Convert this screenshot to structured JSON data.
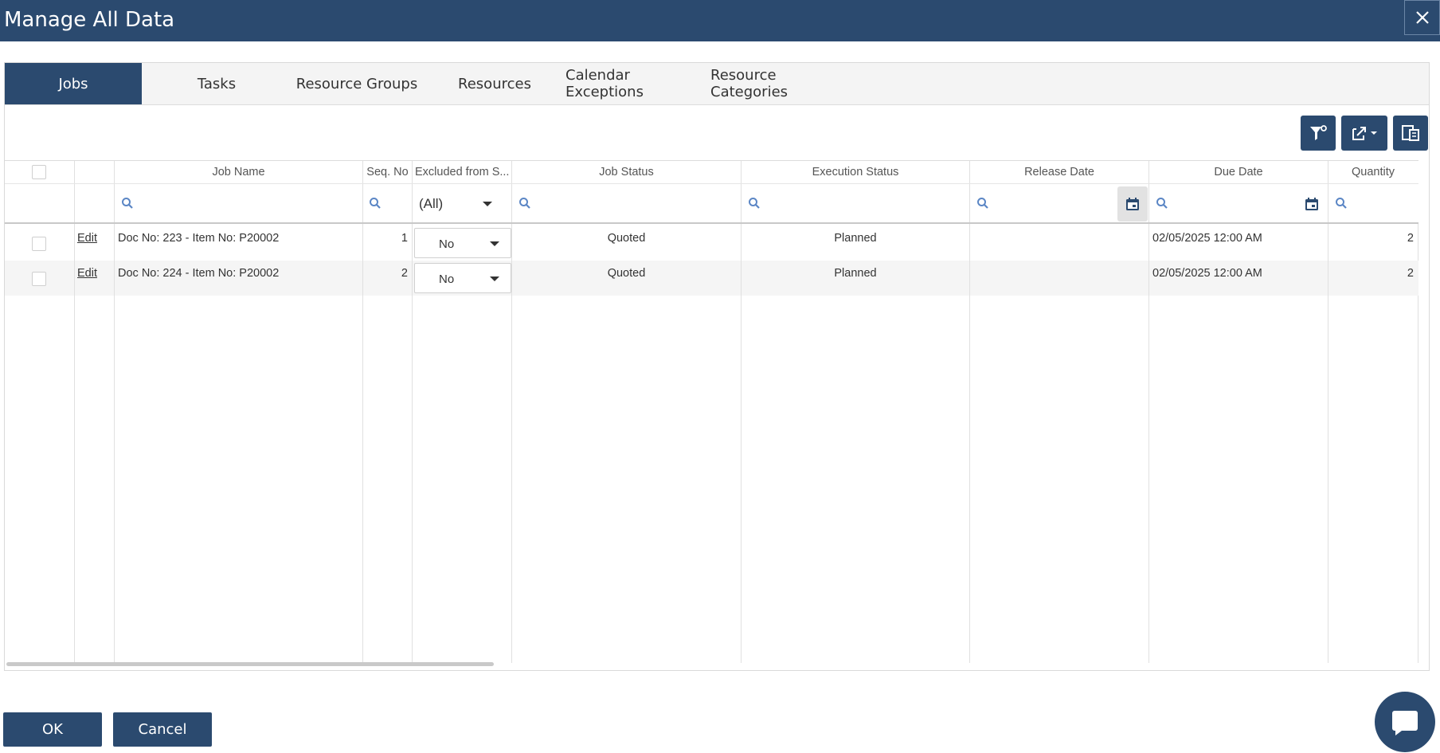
{
  "window": {
    "title": "Manage All Data"
  },
  "tabs": [
    {
      "label": "Jobs",
      "active": true
    },
    {
      "label": "Tasks",
      "active": false
    },
    {
      "label": "Resource Groups",
      "active": false
    },
    {
      "label": "Resources",
      "active": false
    },
    {
      "label": "Calendar Exceptions",
      "active": false
    },
    {
      "label": "Resource Categories",
      "active": false
    }
  ],
  "toolbar": {
    "filter_icon": "filter-settings-icon",
    "export_icon": "export-dropdown-icon",
    "chooser_icon": "column-chooser-icon"
  },
  "grid": {
    "columns": [
      "",
      "",
      "Job Name",
      "Seq. No",
      "Excluded from S...",
      "Job Status",
      "Execution Status",
      "Release Date",
      "Due Date",
      "Quantity"
    ],
    "filters": {
      "excluded": "(All)"
    },
    "rows": [
      {
        "action": "Edit",
        "job_name": "Doc No: 223 - Item No: P20002",
        "seq_no": "1",
        "excluded": "No",
        "job_status": "Quoted",
        "execution_status": "Planned",
        "release_date": "",
        "due_date": "02/05/2025 12:00 AM",
        "quantity": "2"
      },
      {
        "action": "Edit",
        "job_name": "Doc No: 224 - Item No: P20002",
        "seq_no": "2",
        "excluded": "No",
        "job_status": "Quoted",
        "execution_status": "Planned",
        "release_date": "",
        "due_date": "02/05/2025 12:00 AM",
        "quantity": "2"
      }
    ]
  },
  "footer": {
    "ok_label": "OK",
    "cancel_label": "Cancel"
  },
  "colors": {
    "primary": "#2b4a6f",
    "search_icon": "#5b86c5"
  }
}
